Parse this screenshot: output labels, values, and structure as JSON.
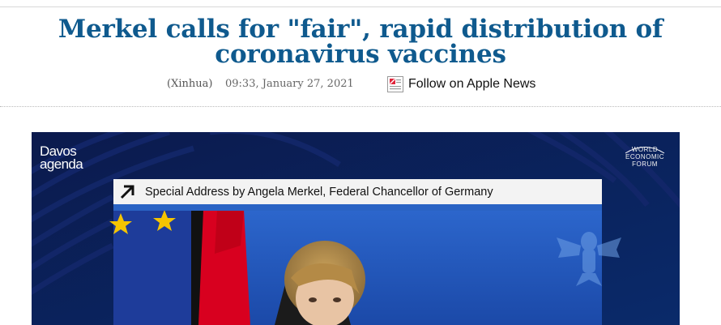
{
  "article": {
    "headline": "Merkel calls for \"fair\", rapid distribution of coronavirus vaccines",
    "source": "(Xinhua)",
    "datetime": "09:33, January 27, 2021",
    "follow_label": "Follow on Apple News",
    "follow_icon": "apple-news-icon"
  },
  "photo": {
    "davos_line1": "Davos",
    "davos_line2": "agenda",
    "wef_line1": "WORLD",
    "wef_line2": "ECONOMIC",
    "wef_line3": "FORUM",
    "caption": "Special Address by Angela Merkel, Federal Chancellor of Germany",
    "colors": {
      "headline": "#0f5a8e",
      "stage_blue": "#1f4fb0",
      "eu_blue": "#1e3c9a",
      "flag_red": "#d8001f",
      "flag_gold": "#f5c400"
    }
  }
}
